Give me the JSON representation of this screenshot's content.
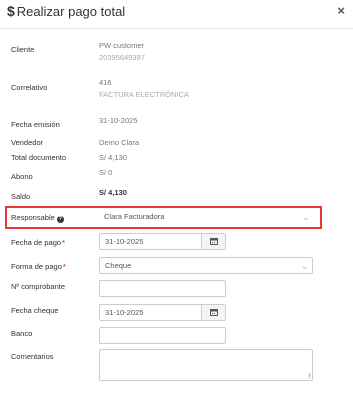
{
  "header": {
    "currency_symbol": "$",
    "title": "Realizar pago total",
    "close": "×"
  },
  "fields": {
    "cliente": {
      "label": "Cliente",
      "name": "PW customer",
      "doc": "20395649397"
    },
    "correlativo": {
      "label": "Correlativo",
      "number": "416",
      "type": "FACTURA ELECTRÓNICA"
    },
    "fecha_emision": {
      "label": "Fecha emisión",
      "value": "31-10-2025"
    },
    "vendedor": {
      "label": "Vendedor",
      "value": "Demo Clara"
    },
    "total": {
      "label": "Total documento",
      "value": "S/ 4,130"
    },
    "abono": {
      "label": "Abono",
      "value": "S/ 0"
    },
    "saldo": {
      "label": "Saldo",
      "value": "S/ 4,130"
    }
  },
  "form": {
    "responsable": {
      "label": "Responsable",
      "help_icon": "question-circle-icon",
      "value": "Clara Facturadora"
    },
    "fecha_pago": {
      "label": "Fecha de pago",
      "required": "*",
      "value": "31-10-2025",
      "icon": "calendar-icon"
    },
    "forma_pago": {
      "label": "Forma de pago",
      "required": "*",
      "value": "Cheque"
    },
    "comprobante": {
      "label": "Nº comprobante",
      "value": ""
    },
    "fecha_cheque": {
      "label": "Fecha cheque",
      "value": "31-10-2025",
      "icon": "calendar-icon"
    },
    "banco": {
      "label": "Banco",
      "value": ""
    },
    "comentarios": {
      "label": "Comentarios",
      "value": ""
    }
  },
  "colors": {
    "highlight": "#e53935",
    "required": "#d9534f"
  }
}
